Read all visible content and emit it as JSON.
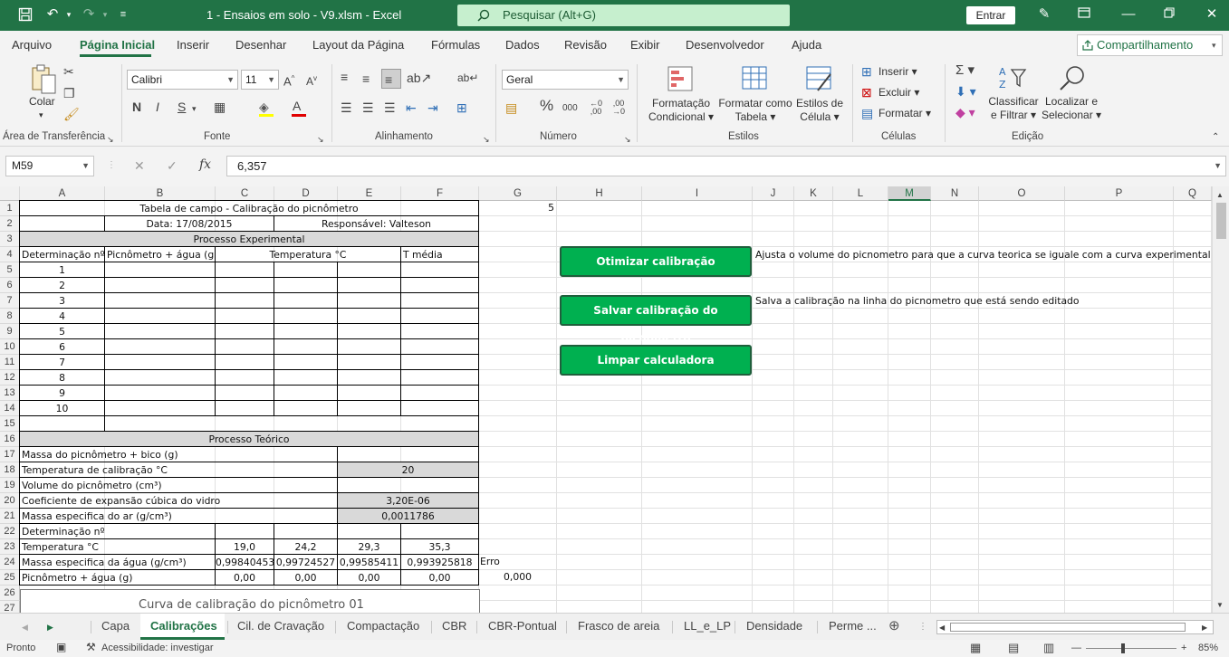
{
  "window": {
    "title": "1 - Ensaios em solo - V9.xlsm  -  Excel",
    "search_placeholder": "Pesquisar (Alt+G)",
    "signin": "Entrar"
  },
  "ribbon_tabs": [
    "Arquivo",
    "Página Inicial",
    "Inserir",
    "Desenhar",
    "Layout da Página",
    "Fórmulas",
    "Dados",
    "Revisão",
    "Exibir",
    "Desenvolvedor",
    "Ajuda"
  ],
  "share": "Compartilhamento",
  "ribbon": {
    "clipboard": {
      "paste": "Colar",
      "label": "Área de Transferência"
    },
    "font": {
      "name": "Calibri",
      "size": "11",
      "label": "Fonte",
      "bold": "N",
      "italic": "I",
      "underline": "S"
    },
    "alignment": {
      "label": "Alinhamento"
    },
    "number": {
      "format": "Geral",
      "label": "Número"
    },
    "styles": {
      "conditional": [
        "Formatação",
        "Condicional"
      ],
      "as_table": [
        "Formatar como",
        "Tabela"
      ],
      "cell_styles": [
        "Estilos de",
        "Célula"
      ],
      "label": "Estilos"
    },
    "cells": {
      "insert": "Inserir",
      "delete": "Excluir",
      "format": "Formatar",
      "label": "Células"
    },
    "editing": {
      "sort": [
        "Classificar",
        "e Filtrar"
      ],
      "find": [
        "Localizar e",
        "Selecionar"
      ],
      "label": "Edição"
    }
  },
  "formula_bar": {
    "name_box": "M59",
    "formula": "6,357"
  },
  "columns": [
    "A",
    "B",
    "C",
    "D",
    "E",
    "F",
    "G",
    "H",
    "I",
    "J",
    "K",
    "L",
    "M",
    "N",
    "O",
    "P",
    "Q"
  ],
  "selected_column": "M",
  "rows": [
    "1",
    "2",
    "3",
    "4",
    "5",
    "6",
    "7",
    "8",
    "9",
    "10",
    "11",
    "12",
    "13",
    "14",
    "15",
    "16",
    "17",
    "18",
    "19",
    "20",
    "21",
    "22",
    "23",
    "24",
    "25",
    "26",
    "27"
  ],
  "sheet": {
    "r1_title": "Tabela de campo - Calibração do picnômetro",
    "g1": "5",
    "r2_date": "Data: 17/08/2015",
    "r2_resp": "Responsável: Valteson",
    "r3_exp": "Processo Experimental",
    "r4_headers": [
      "Determinação nº",
      "Picnômetro + água (g)",
      "Temperatura °C",
      "T média"
    ],
    "determinations": [
      "1",
      "2",
      "3",
      "4",
      "5",
      "6",
      "7",
      "8",
      "9",
      "10"
    ],
    "r16_theory": "Processo Teórico",
    "labels": {
      "r17": "Massa do picnômetro + bico (g)",
      "r18": "Temperatura de calibração °C",
      "r19": "Volume do picnômetro (cm³)",
      "r20": "Coeficiente de expansão cúbica do vidro",
      "r21": "Massa especifica do ar (g/cm³)",
      "r22": "Determinação nº",
      "r23": "Temperatura °C",
      "r24": "Massa especifica da água (g/cm³)",
      "r25": "Picnômetro + água (g)"
    },
    "r18_val": "20",
    "r20_val": "3,20E-06",
    "r21_val": "0,0011786",
    "r23_vals": [
      "19,0",
      "24,2",
      "29,3",
      "35,3"
    ],
    "r24_vals": [
      "0,99840453",
      "0,99724527",
      "0,99585411",
      "0,993925818"
    ],
    "r24_g": "Erro",
    "r25_vals": [
      "0,00",
      "0,00",
      "0,00",
      "0,00"
    ],
    "r25_g": "0,000",
    "chart_title": "Curva de calibração do picnômetro 01"
  },
  "buttons": {
    "optimize": "Otimizar calibração",
    "save": "Salvar calibração do picnometro",
    "clear": "Limpar calculadora"
  },
  "notes": {
    "optimize": "Ajusta o volume do picnometro para que a curva teorica se iguale com a curva experimental",
    "save": "Salva a calibração na linha do picnometro que está sendo editado"
  },
  "sheet_tabs": [
    "Capa",
    "Calibrações",
    "Cil. de Cravação",
    "Compactação",
    "CBR",
    "CBR-Pontual",
    "Frasco de areia",
    "LL_e_LP",
    "Densidade",
    "Perme ..."
  ],
  "active_sheet": "Calibrações",
  "status": {
    "ready": "Pronto",
    "accessibility": "Acessibilidade: investigar",
    "zoom": "85%"
  },
  "colors": {
    "brand": "#217346",
    "button": "#00b050",
    "search": "#c6efce"
  }
}
